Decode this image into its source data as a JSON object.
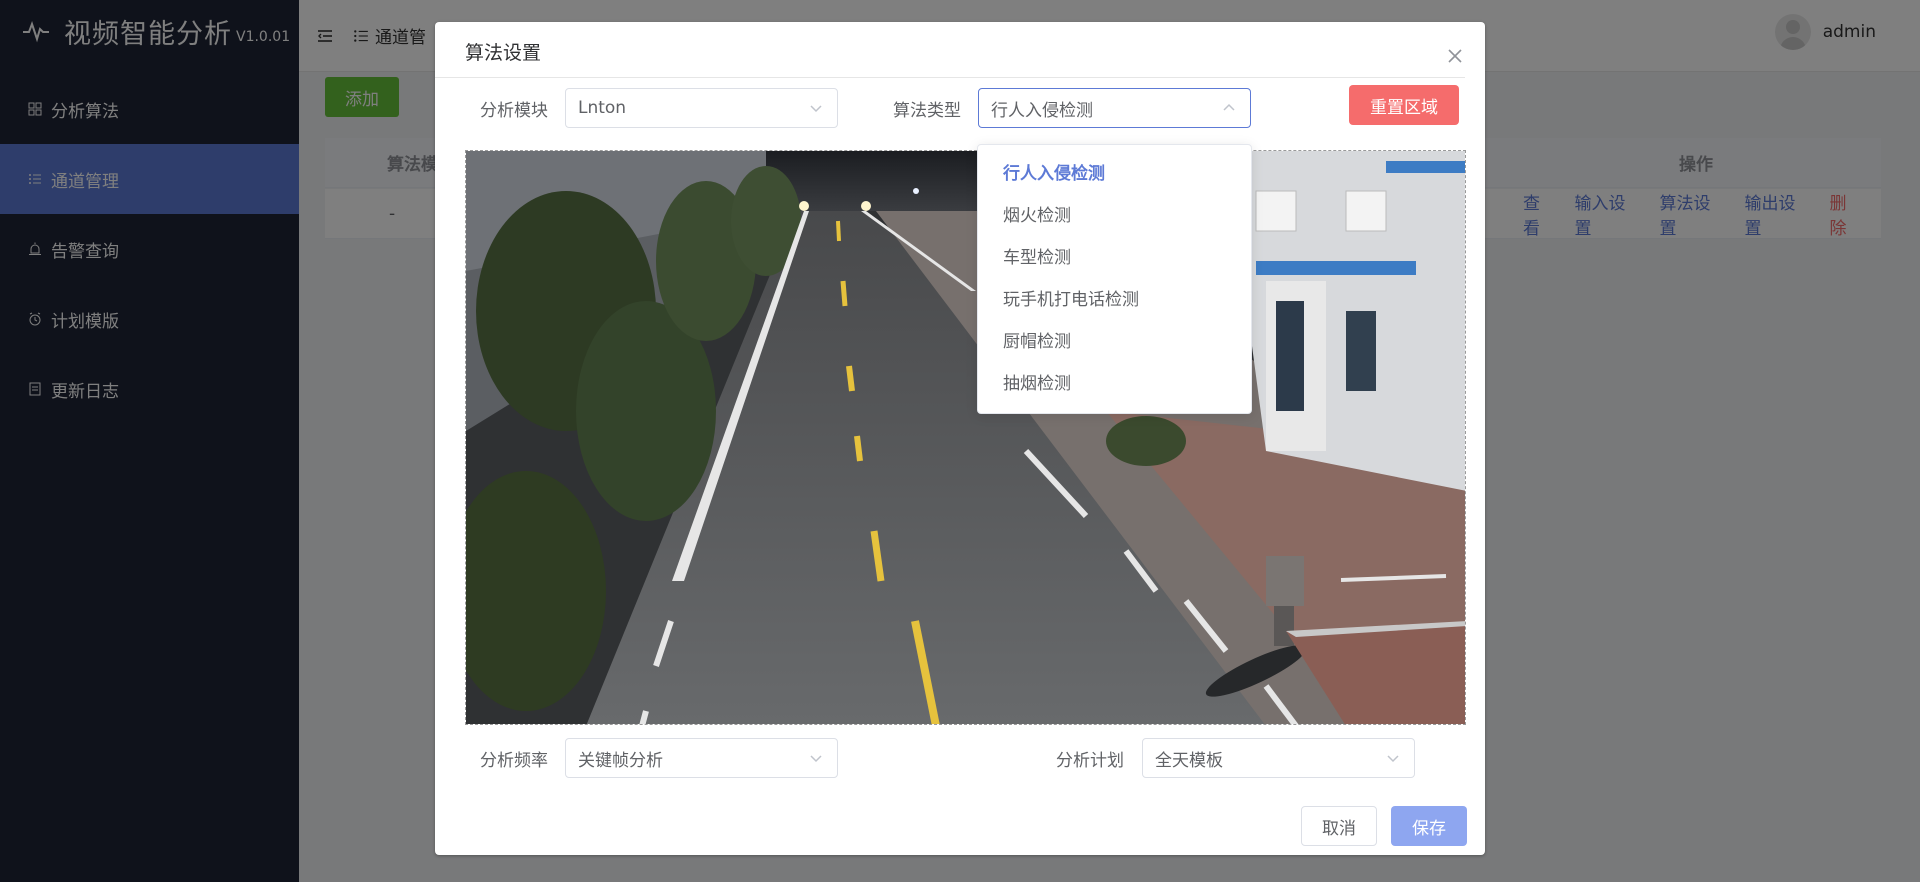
{
  "app": {
    "title": "视频智能分析",
    "version": "V1.0.01"
  },
  "sidebar": {
    "items": [
      {
        "label": "分析算法"
      },
      {
        "label": "通道管理"
      },
      {
        "label": "告警查询"
      },
      {
        "label": "计划模版"
      },
      {
        "label": "更新日志"
      }
    ]
  },
  "topbar": {
    "breadcrumb": "通道管",
    "user": "admin"
  },
  "main": {
    "add_label": "添加",
    "table": {
      "header_first": "算法模",
      "header_ops": "操作",
      "row_first": "-",
      "row_ops": [
        "查看",
        "输入设置",
        "算法设置",
        "输出设置",
        "删除"
      ]
    }
  },
  "dialog": {
    "title": "算法设置",
    "module_label": "分析模块",
    "module_value": "Lnton",
    "type_label": "算法类型",
    "type_value": "行人入侵检测",
    "reset_label": "重置区域",
    "freq_label": "分析频率",
    "freq_value": "关键帧分析",
    "plan_label": "分析计划",
    "plan_value": "全天模板",
    "cancel_label": "取消",
    "save_label": "保存",
    "dropdown_options": [
      "行人入侵检测",
      "烟火检测",
      "车型检测",
      "玩手机打电话检测",
      "厨帽检测",
      "抽烟检测"
    ]
  },
  "colors": {
    "sidebar_bg": "#1f2536",
    "accent": "#5d7ad6",
    "danger": "#f56c6c",
    "success": "#67c23a"
  }
}
